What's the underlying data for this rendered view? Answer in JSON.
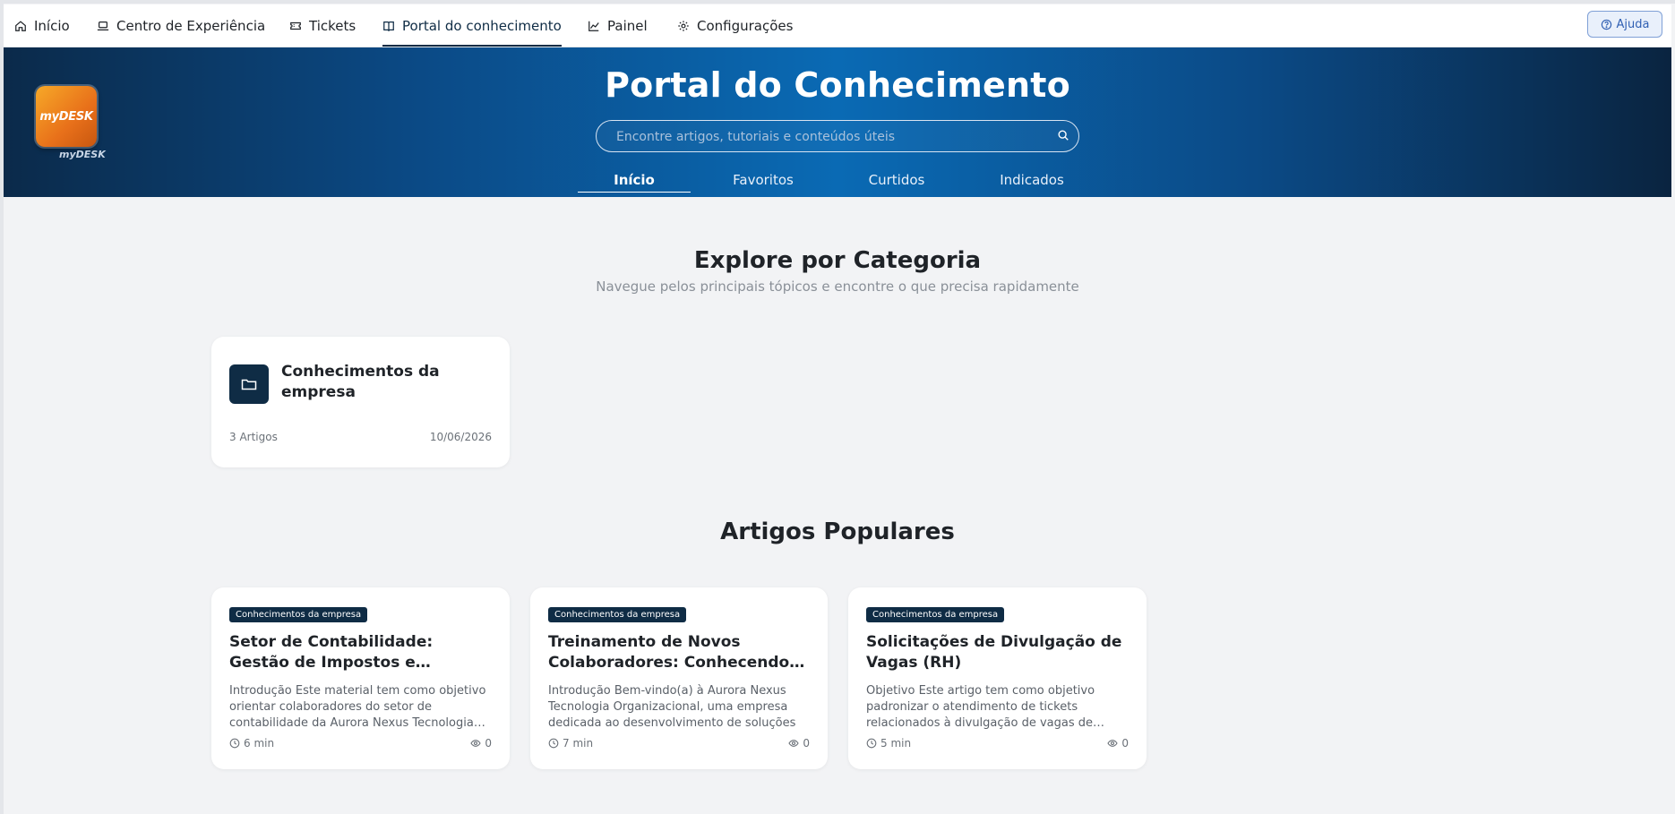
{
  "nav": {
    "items": [
      {
        "label": "Início",
        "icon": "home-icon"
      },
      {
        "label": "Centro de Experiência",
        "icon": "laptop-icon"
      },
      {
        "label": "Tickets",
        "icon": "ticket-icon"
      },
      {
        "label": "Portal do conhecimento",
        "icon": "book-icon",
        "active": true
      },
      {
        "label": "Painel",
        "icon": "chart-line-icon"
      },
      {
        "label": "Configurações",
        "icon": "gear-icon"
      }
    ],
    "help_label": "Ajuda"
  },
  "hero": {
    "logo_text": "myDESK",
    "logo_sub": "myDESK",
    "title": "Portal do Conhecimento",
    "search_placeholder": "Encontre artigos, tutoriais e conteúdos úteis",
    "tabs": [
      "Início",
      "Favoritos",
      "Curtidos",
      "Indicados"
    ],
    "active_tab": "Início"
  },
  "categories": {
    "title": "Explore por Categoria",
    "subtitle": "Navegue pelos principais tópicos e encontre o que precisa rapidamente",
    "items": [
      {
        "name": "Conhecimentos da empresa",
        "count": "3 Artigos",
        "date": "10/06/2026",
        "icon": "folder-icon"
      }
    ]
  },
  "popular": {
    "title": "Artigos Populares",
    "articles": [
      {
        "category": "Conhecimentos da empresa",
        "title": "Setor de Contabilidade: Gestão de Impostos e Obrigações Fiscais – Aurora Nexus",
        "excerpt": "Introdução Este material tem como objetivo orientar colaboradores do setor de contabilidade da Aurora Nexus Tecnologia Organizacional",
        "time": "6 min",
        "views": "0"
      },
      {
        "category": "Conhecimentos da empresa",
        "title": "Treinamento de Novos Colaboradores: Conhecendo a Aurora Nexus",
        "excerpt": "Introdução Bem-vindo(a) à Aurora Nexus Tecnologia Organizacional, uma empresa dedicada ao desenvolvimento de soluções",
        "time": "7 min",
        "views": "0"
      },
      {
        "category": "Conhecimentos da empresa",
        "title": "Solicitações de Divulgação de Vagas (RH)",
        "excerpt": "Objetivo Este artigo tem como objetivo padronizar o atendimento de tickets relacionados à divulgação de vagas de emprego",
        "time": "5 min",
        "views": "0"
      }
    ]
  },
  "colors": {
    "primary": "#0f2c45",
    "hero_center": "#0a6ab4",
    "background": "#f2f3f5",
    "help": "#2f5fb3"
  }
}
